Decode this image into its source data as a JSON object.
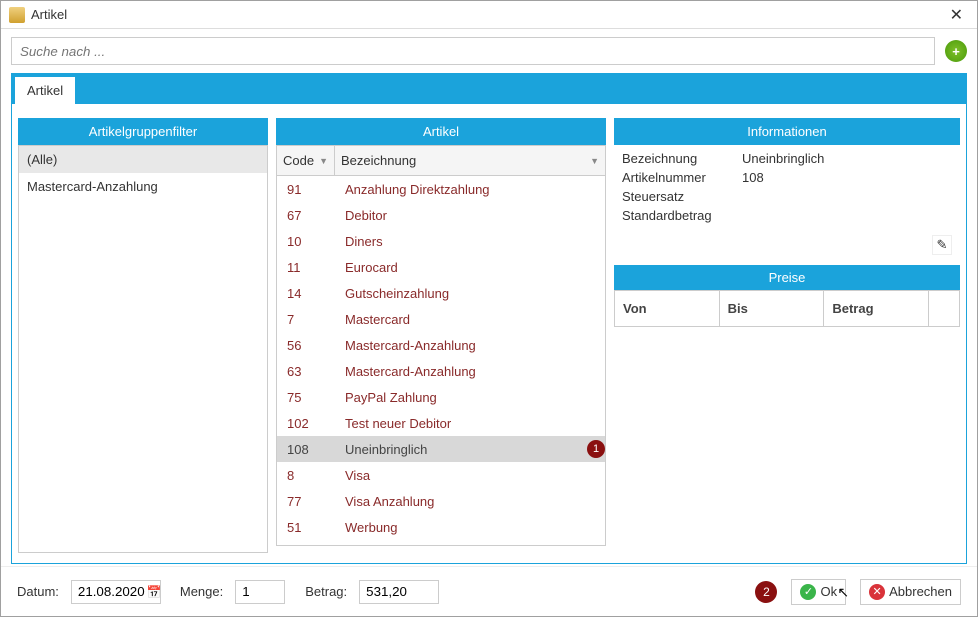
{
  "window": {
    "title": "Artikel"
  },
  "search": {
    "placeholder": "Suche nach ..."
  },
  "tabs": {
    "artikel": "Artikel"
  },
  "panels": {
    "filter": "Artikelgruppenfilter",
    "artikel": "Artikel",
    "info": "Informationen",
    "preise": "Preise"
  },
  "groups": [
    {
      "label": "(Alle)",
      "selected": true
    },
    {
      "label": "Mastercard-Anzahlung",
      "selected": false
    }
  ],
  "grid": {
    "headers": {
      "code": "Code",
      "bez": "Bezeichnung"
    },
    "rows": [
      {
        "code": "91",
        "bez": "Anzahlung Direktzahlung"
      },
      {
        "code": "67",
        "bez": "Debitor"
      },
      {
        "code": "10",
        "bez": "Diners"
      },
      {
        "code": "11",
        "bez": "Eurocard"
      },
      {
        "code": "14",
        "bez": "Gutscheinzahlung"
      },
      {
        "code": "7",
        "bez": "Mastercard"
      },
      {
        "code": "56",
        "bez": "Mastercard-Anzahlung"
      },
      {
        "code": "63",
        "bez": "Mastercard-Anzahlung"
      },
      {
        "code": "75",
        "bez": "PayPal Zahlung"
      },
      {
        "code": "102",
        "bez": "Test neuer Debitor"
      },
      {
        "code": "108",
        "bez": "Uneinbringlich",
        "selected": true,
        "badge": "1"
      },
      {
        "code": "8",
        "bez": "Visa"
      },
      {
        "code": "77",
        "bez": "Visa Anzahlung"
      },
      {
        "code": "51",
        "bez": "Werbung"
      }
    ]
  },
  "info": {
    "labels": {
      "bez": "Bezeichnung",
      "nr": "Artikelnummer",
      "steuer": "Steuersatz",
      "std": "Standardbetrag"
    },
    "values": {
      "bez": "Uneinbringlich",
      "nr": "108",
      "steuer": "",
      "std": ""
    }
  },
  "price_headers": {
    "von": "Von",
    "bis": "Bis",
    "betrag": "Betrag"
  },
  "footer": {
    "labels": {
      "datum": "Datum:",
      "menge": "Menge:",
      "betrag": "Betrag:"
    },
    "values": {
      "datum": "21.08.2020",
      "menge": "1",
      "betrag": "531,20"
    },
    "buttons": {
      "ok": "Ok",
      "abbrechen": "Abbrechen"
    },
    "badge": "2"
  }
}
